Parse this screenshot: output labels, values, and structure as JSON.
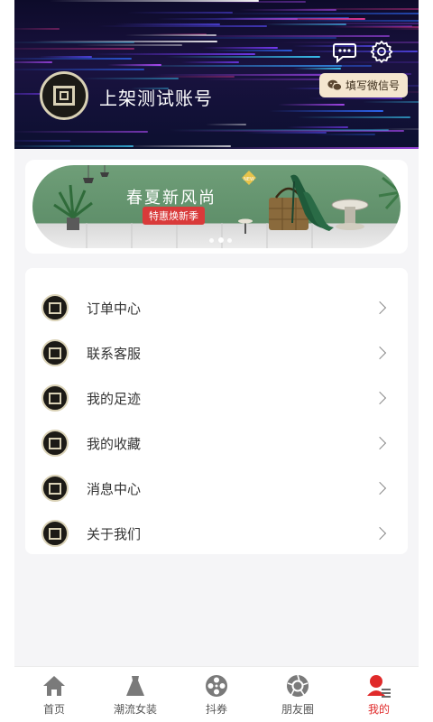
{
  "header": {
    "username": "上架测试账号",
    "wechat_chip_label": "填写微信号",
    "icons": [
      "chat-icon",
      "gear-icon",
      "wechat-icon"
    ]
  },
  "banner": {
    "title": "春夏新风尚",
    "subtitle": "特惠焕新季",
    "slide_count": 3,
    "active_slide": 2
  },
  "menu": {
    "items": [
      {
        "label": "订单中心"
      },
      {
        "label": "联系客服"
      },
      {
        "label": "我的足迹"
      },
      {
        "label": "我的收藏"
      },
      {
        "label": "消息中心"
      },
      {
        "label": "关于我们"
      }
    ]
  },
  "bottom_nav": {
    "items": [
      {
        "label": "首页",
        "icon": "home-icon"
      },
      {
        "label": "潮流女装",
        "icon": "dress-icon"
      },
      {
        "label": "抖券",
        "icon": "film-reel-icon"
      },
      {
        "label": "朋友圈",
        "icon": "aperture-icon"
      },
      {
        "label": "我的",
        "icon": "profile-icon",
        "active": true
      }
    ]
  },
  "colors": {
    "accent": "#e02a2a",
    "gold": "#d9d1b5",
    "chip": "#f4e6cf",
    "banner_green": "#6f9e78"
  }
}
